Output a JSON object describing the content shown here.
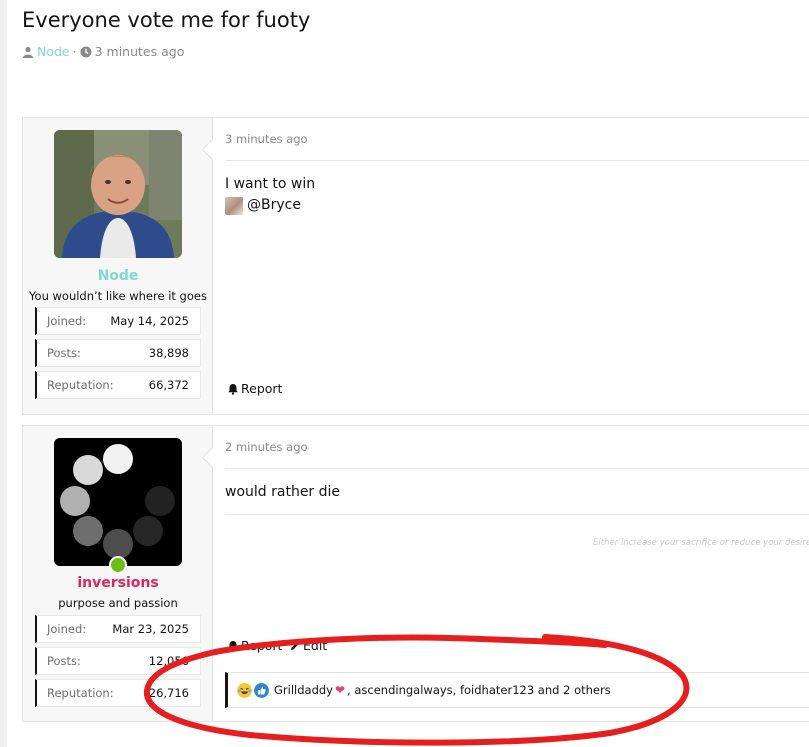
{
  "thread": {
    "title": "Everyone vote me for fuoty",
    "author": "Node",
    "separator": "·",
    "time": "3 minutes ago"
  },
  "posts": [
    {
      "time": "3 minutes ago",
      "body_line1": "I want to win",
      "mention": "@Bryce",
      "report_label": "Report",
      "user": {
        "name": "Node",
        "name_color": "#7fd9d0",
        "title": "You wouldn’t like where it goes",
        "stats": [
          {
            "label": "Joined:",
            "value": "May 14, 2025"
          },
          {
            "label": "Posts:",
            "value": "38,898"
          },
          {
            "label": "Reputation:",
            "value": "66,372"
          }
        ]
      }
    },
    {
      "time": "2 minutes ago",
      "body_line1": "would rather die",
      "signature": "Either increase your sacrifice or reduce your desire.",
      "report_label": "Report",
      "edit_label": "Edit",
      "user": {
        "name": "inversions",
        "name_color": "#e0245e",
        "title": "purpose and passion",
        "online_color": "#6bbf17",
        "stats": [
          {
            "label": "Joined:",
            "value": "Mar 23, 2025"
          },
          {
            "label": "Posts:",
            "value": "12,056"
          },
          {
            "label": "Reputation:",
            "value": "26,716"
          }
        ]
      },
      "reactions": {
        "first_user": "Grilldaddy",
        "rest": ", ascendingalways, foidhater123 and 2 others",
        "icons": [
          "laughing-emoji-icon",
          "like-thumb-icon",
          "heart-icon"
        ]
      }
    }
  ],
  "colors": {
    "accent_teal": "#7fd9d0",
    "accent_pink": "#e0245e",
    "annotation_red": "#e61e1e"
  }
}
